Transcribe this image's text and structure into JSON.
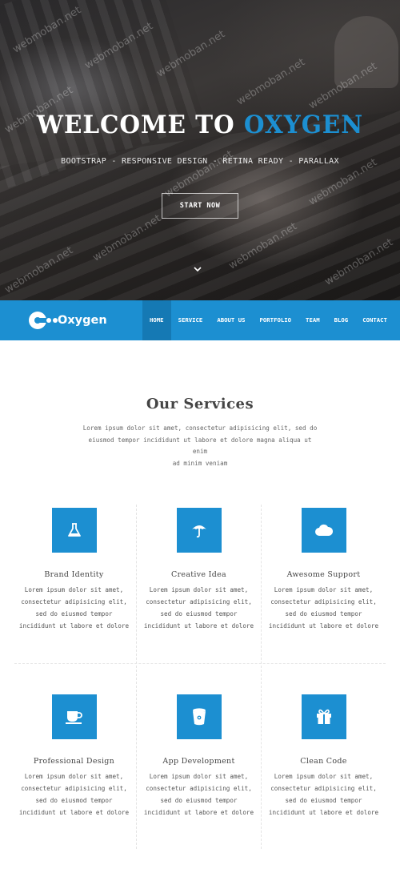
{
  "hero": {
    "title_main": "WELCOME TO ",
    "title_accent": "OXYGEN",
    "subtitle": "BOOTSTRAP - RESPONSIVE DESIGN - RETINA READY - PARALLAX",
    "start_button": "START NOW",
    "watermark": "webmoban.net"
  },
  "navbar": {
    "logo_text": "Oxygen",
    "items": [
      {
        "label": "HOME",
        "active": true
      },
      {
        "label": "SERVICE",
        "active": false
      },
      {
        "label": "ABOUT US",
        "active": false
      },
      {
        "label": "PORTFOLIO",
        "active": false
      },
      {
        "label": "TEAM",
        "active": false
      },
      {
        "label": "BLOG",
        "active": false
      },
      {
        "label": "CONTACT",
        "active": false
      }
    ]
  },
  "services": {
    "title": "Our Services",
    "desc_lines": [
      "Lorem ipsum dolor sit amet, consectetur adipisicing elit, sed do",
      "eiusmod tempor incididunt ut labore et dolore magna aliqua ut enim",
      "ad minim veniam"
    ],
    "items": [
      {
        "icon": "flask-icon",
        "title": "Brand Identity",
        "lines": [
          "Lorem ipsum dolor sit amet,",
          "consectetur adipisicing elit,",
          "sed do eiusmod tempor",
          "incididunt ut labore et dolore"
        ]
      },
      {
        "icon": "umbrella-icon",
        "title": "Creative Idea",
        "lines": [
          "Lorem ipsum dolor sit amet,",
          "consectetur adipisicing elit,",
          "sed do eiusmod tempor",
          "incididunt ut labore et dolore"
        ]
      },
      {
        "icon": "cloud-icon",
        "title": "Awesome Support",
        "lines": [
          "Lorem ipsum dolor sit amet,",
          "consectetur adipisicing elit,",
          "sed do eiusmod tempor",
          "incididunt ut labore et dolore"
        ]
      },
      {
        "icon": "coffee-cup-icon",
        "title": "Professional Design",
        "lines": [
          "Lorem ipsum dolor sit amet,",
          "consectetur adipisicing elit,",
          "sed do eiusmod tempor",
          "incididunt ut labore et dolore"
        ]
      },
      {
        "icon": "bitbucket-icon",
        "title": "App Development",
        "lines": [
          "Lorem ipsum dolor sit amet,",
          "consectetur adipisicing elit,",
          "sed do eiusmod tempor",
          "incididunt ut labore et dolore"
        ]
      },
      {
        "icon": "gift-icon",
        "title": "Clean Code",
        "lines": [
          "Lorem ipsum dolor sit amet,",
          "consectetur adipisicing elit,",
          "sed do eiusmod tempor",
          "incididunt ut labore et dolore"
        ]
      }
    ]
  },
  "colors": {
    "accent": "#1c8fd1",
    "accent_dark": "#1579b4",
    "hero_text": "#ffffff"
  }
}
